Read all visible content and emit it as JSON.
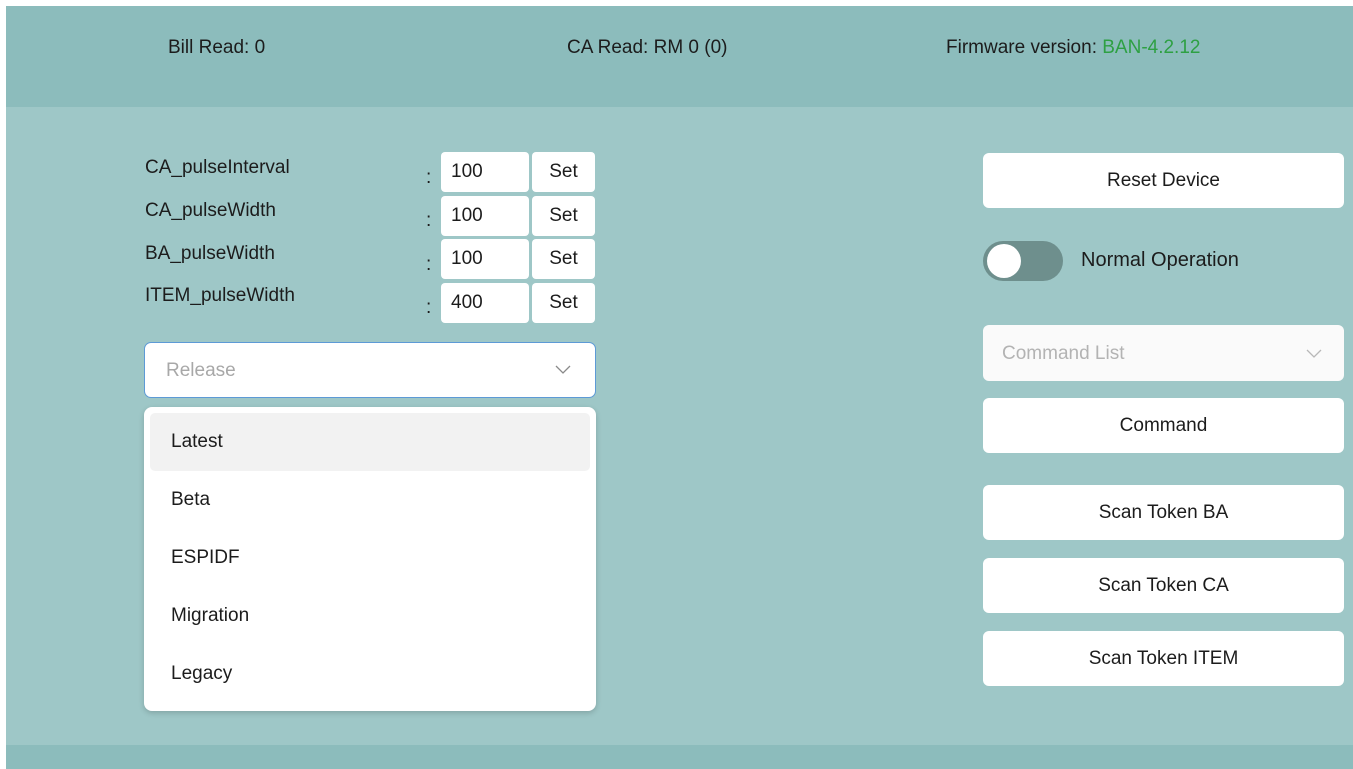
{
  "header": {
    "bill_read": "Bill Read: 0",
    "ca_read": "CA Read: RM 0 (0)",
    "firmware_label": "Firmware version: ",
    "firmware_version": "BAN-4.2.12"
  },
  "params": [
    {
      "label": "CA_pulseInterval",
      "value": "100",
      "set_label": "Set"
    },
    {
      "label": "CA_pulseWidth",
      "value": "100",
      "set_label": "Set"
    },
    {
      "label": "BA_pulseWidth",
      "value": "100",
      "set_label": "Set"
    },
    {
      "label": "ITEM_pulseWidth",
      "value": "400",
      "set_label": "Set"
    }
  ],
  "colon": ":",
  "release": {
    "placeholder": "Release",
    "options": [
      "Latest",
      "Beta",
      "ESPIDF",
      "Migration",
      "Legacy"
    ],
    "highlighted": "Latest"
  },
  "right_panel": {
    "reset_label": "Reset Device",
    "mode_label": "Normal Operation",
    "mode_on": false,
    "command_list_placeholder": "Command List",
    "command_label": "Command",
    "scan_ba_label": "Scan Token BA",
    "scan_ca_label": "Scan Token CA",
    "scan_item_label": "Scan Token ITEM"
  },
  "colors": {
    "background": "#9ec7c7",
    "header": "#8cbcbc",
    "firmware_version": "#2ea043",
    "combo_border": "#5d9ad6",
    "toggle_track": "#6e8f8d"
  },
  "icons": [
    "chevron-down-icon"
  ]
}
